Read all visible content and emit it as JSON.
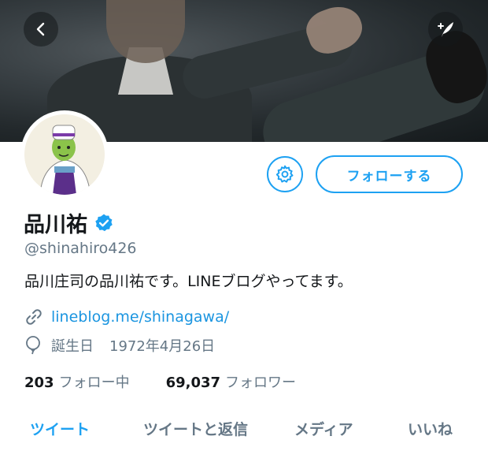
{
  "header": {
    "back_icon": "chevron-left-icon",
    "compose_icon": "compose-feather-icon"
  },
  "profile": {
    "name": "品川祐",
    "handle": "@shinahiro426",
    "bio": "品川庄司の品川祐です。LINEブログやってます。",
    "link": "lineblog.me/shinagawa/",
    "birthday_label": "誕生日",
    "birthday": "1972年4月26日",
    "verified_icon": "verified-badge-icon"
  },
  "actions": {
    "settings_icon": "gear-icon",
    "follow_label": "フォローする"
  },
  "stats": {
    "following_count": "203",
    "following_label": "フォロー中",
    "followers_count": "69,037",
    "followers_label": "フォロワー"
  },
  "tabs": [
    {
      "label": "ツイート",
      "active": true
    },
    {
      "label": "ツイートと返信",
      "active": false
    },
    {
      "label": "メディア",
      "active": false
    },
    {
      "label": "いいね",
      "active": false
    }
  ],
  "colors": {
    "accent": "#1da1f2",
    "link": "#1b95e0",
    "secondary_text": "#657786",
    "primary_text": "#14171a"
  }
}
